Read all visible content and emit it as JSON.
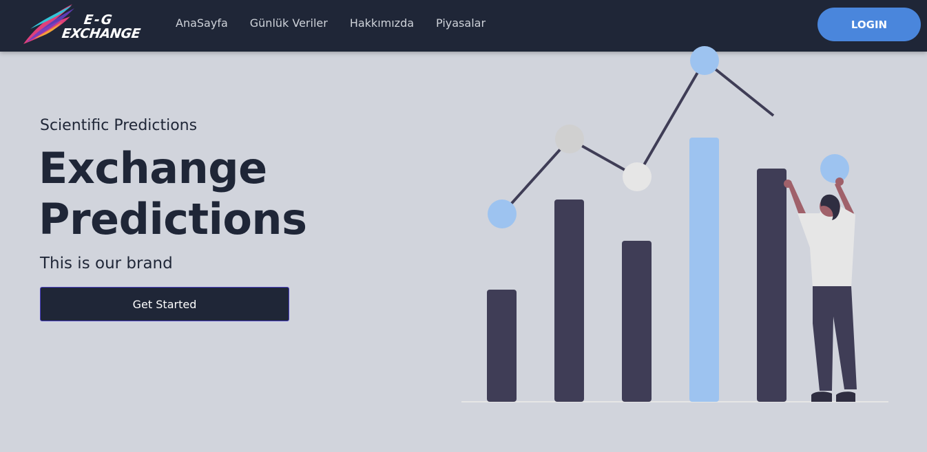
{
  "brand": {
    "line1": "E-G",
    "line2": "EXCHANGE"
  },
  "nav": {
    "items": [
      {
        "label": "AnaSayfa"
      },
      {
        "label": "Günlük Veriler"
      },
      {
        "label": "Hakkımızda"
      },
      {
        "label": "Piyasalar"
      }
    ],
    "login_label": "LOGIN"
  },
  "hero": {
    "subtitle": "Scientific Predictions",
    "title_line1": "Exchange",
    "title_line2": "Predictions",
    "tagline": "This is our brand",
    "cta_label": "Get Started"
  },
  "colors": {
    "navbar_bg": "#1f2637",
    "page_bg": "#d1d4dc",
    "accent_blue": "#4a86dc",
    "bar_dark": "#3f3d56",
    "bar_light": "#9dc3f0"
  }
}
